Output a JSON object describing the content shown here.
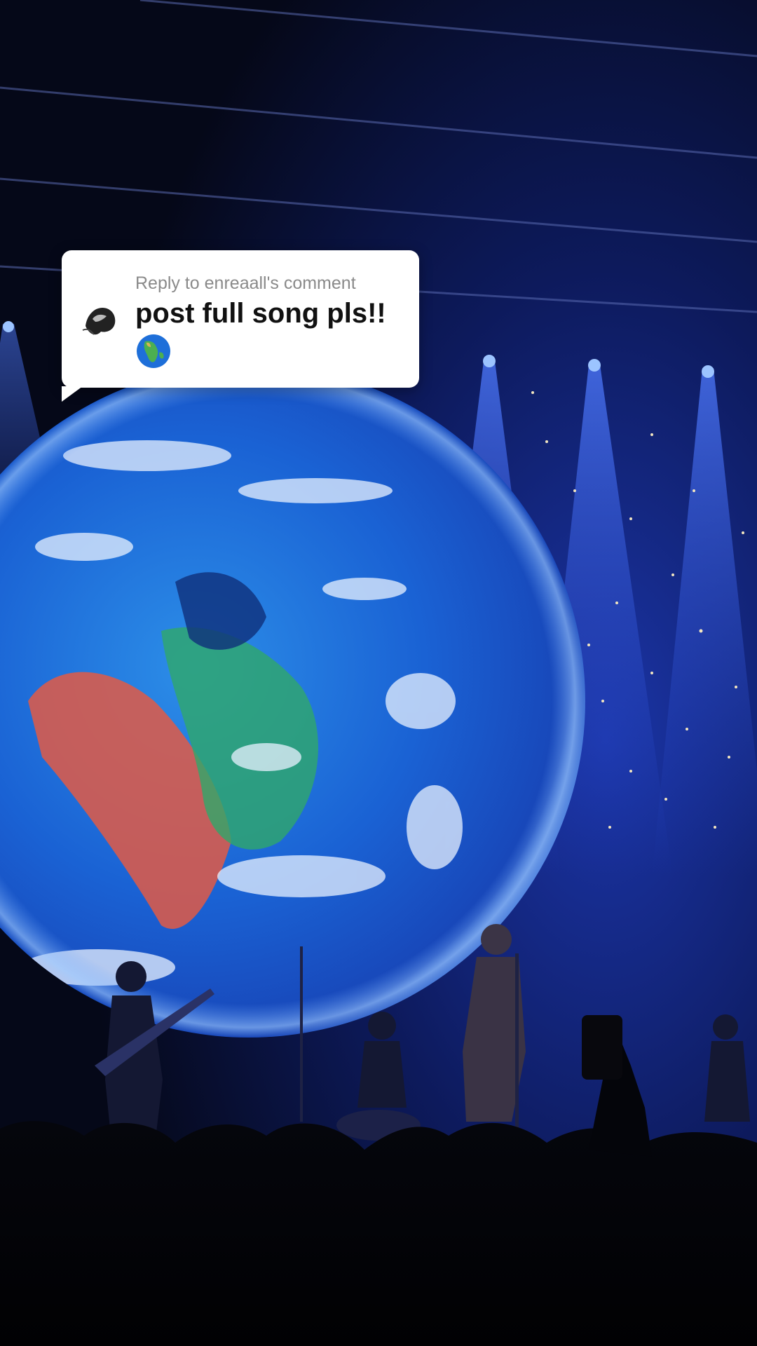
{
  "reply_sticker": {
    "reply_label": "Reply to enreaall's comment",
    "comment_text": "post full song pls!!",
    "emoji": "globe-showing-africa-emoji"
  },
  "colors": {
    "stage_background": "#060a1e",
    "stage_light_blue": "#2a5cff",
    "earth_ocean": "#1f6fe0",
    "sticker_background": "#ffffff",
    "reply_label_color": "#8a8a8a",
    "comment_text_color": "#111111"
  }
}
